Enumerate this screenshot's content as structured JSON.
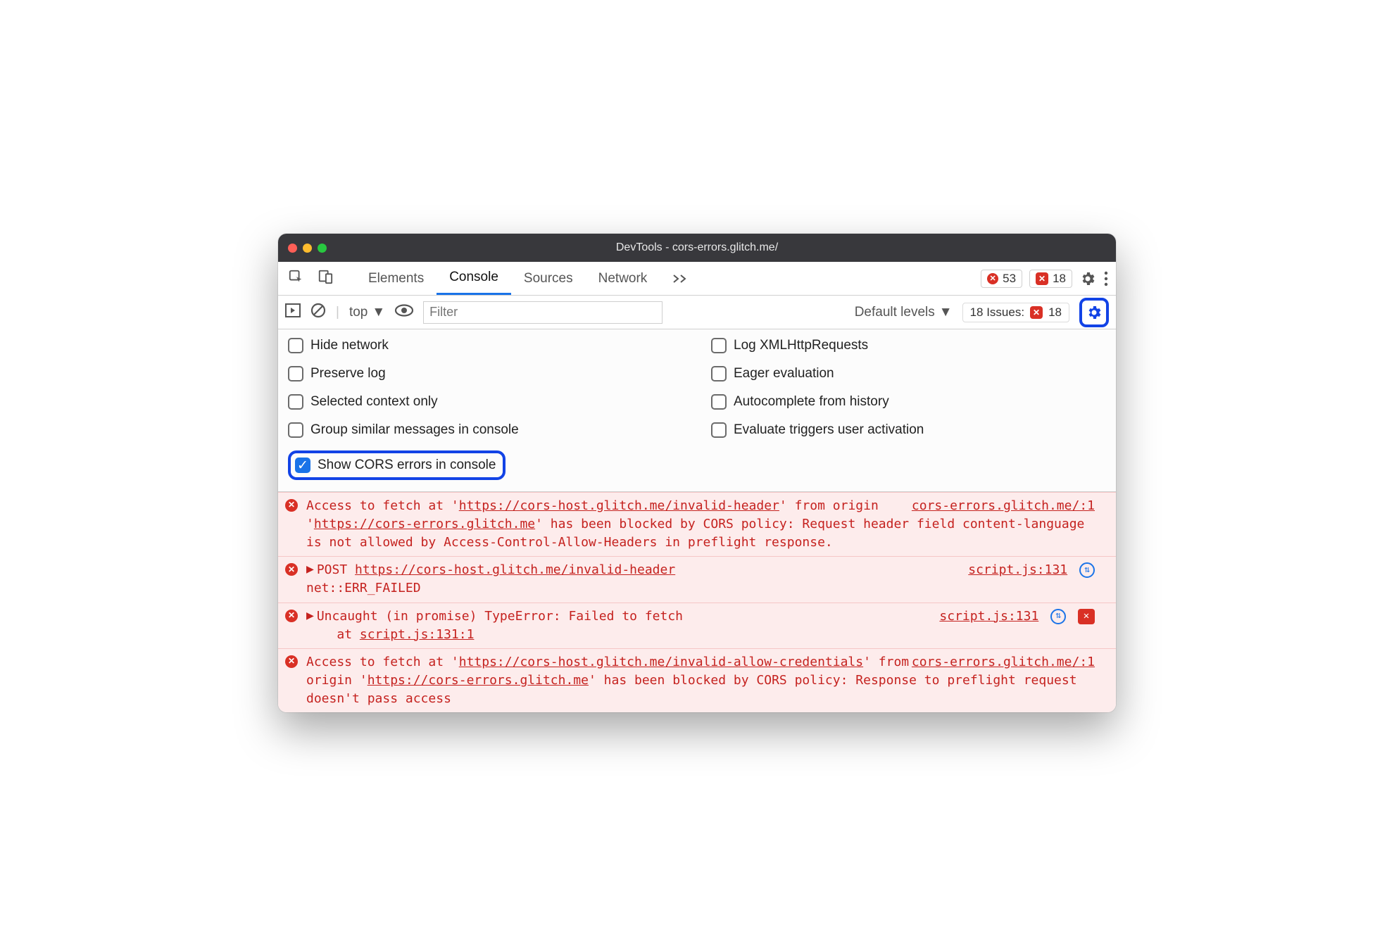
{
  "window": {
    "title": "DevTools - cors-errors.glitch.me/"
  },
  "tabs": {
    "items": [
      "Elements",
      "Console",
      "Sources",
      "Network"
    ],
    "active_index": 1
  },
  "top_badges": {
    "errors_count": "53",
    "issues_count": "18"
  },
  "toolbar": {
    "context_label": "top",
    "filter_placeholder": "Filter",
    "levels_label": "Default levels",
    "issues_label": "18 Issues:",
    "issues_badge_count": "18"
  },
  "settings": {
    "left": [
      {
        "label": "Hide network",
        "checked": false
      },
      {
        "label": "Preserve log",
        "checked": false
      },
      {
        "label": "Selected context only",
        "checked": false
      },
      {
        "label": "Group similar messages in console",
        "checked": false
      },
      {
        "label": "Show CORS errors in console",
        "checked": true,
        "highlighted": true
      }
    ],
    "right": [
      {
        "label": "Log XMLHttpRequests",
        "checked": false
      },
      {
        "label": "Eager evaluation",
        "checked": false
      },
      {
        "label": "Autocomplete from history",
        "checked": false
      },
      {
        "label": "Evaluate triggers user activation",
        "checked": false
      }
    ]
  },
  "log": [
    {
      "kind": "cors",
      "text_pre": "Access to fetch at '",
      "url1": "https://cors-host.glitch.me/invalid-header",
      "mid1": "' from origin '",
      "url2": "https://cors-errors.glitch.me",
      "tail": "' has been blocked by CORS policy: Request header field content-language is not allowed by Access-Control-Allow-Headers in preflight response.",
      "source": "cors-errors.glitch.me/:1"
    },
    {
      "kind": "net",
      "method": "POST",
      "url": "https://cors-host.glitch.me/invalid-header",
      "status": "net::ERR_FAILED",
      "source": "script.js:131",
      "has_cycle": true
    },
    {
      "kind": "uncaught",
      "line1": "Uncaught (in promise) TypeError: Failed to fetch",
      "line2_prefix": "at ",
      "line2_link": "script.js:131:1",
      "source": "script.js:131",
      "has_cycle": true,
      "has_issue_chip": true
    },
    {
      "kind": "cors",
      "text_pre": "Access to fetch at '",
      "url1": "https://cors-host.glitch.me/invalid-allow-credentials",
      "mid1": "' from origin '",
      "url2": "https://cors-errors.glitch.me",
      "tail": "' has been blocked by CORS policy: Response to preflight request doesn't pass access",
      "source": "cors-errors.glitch.me/:1"
    }
  ]
}
